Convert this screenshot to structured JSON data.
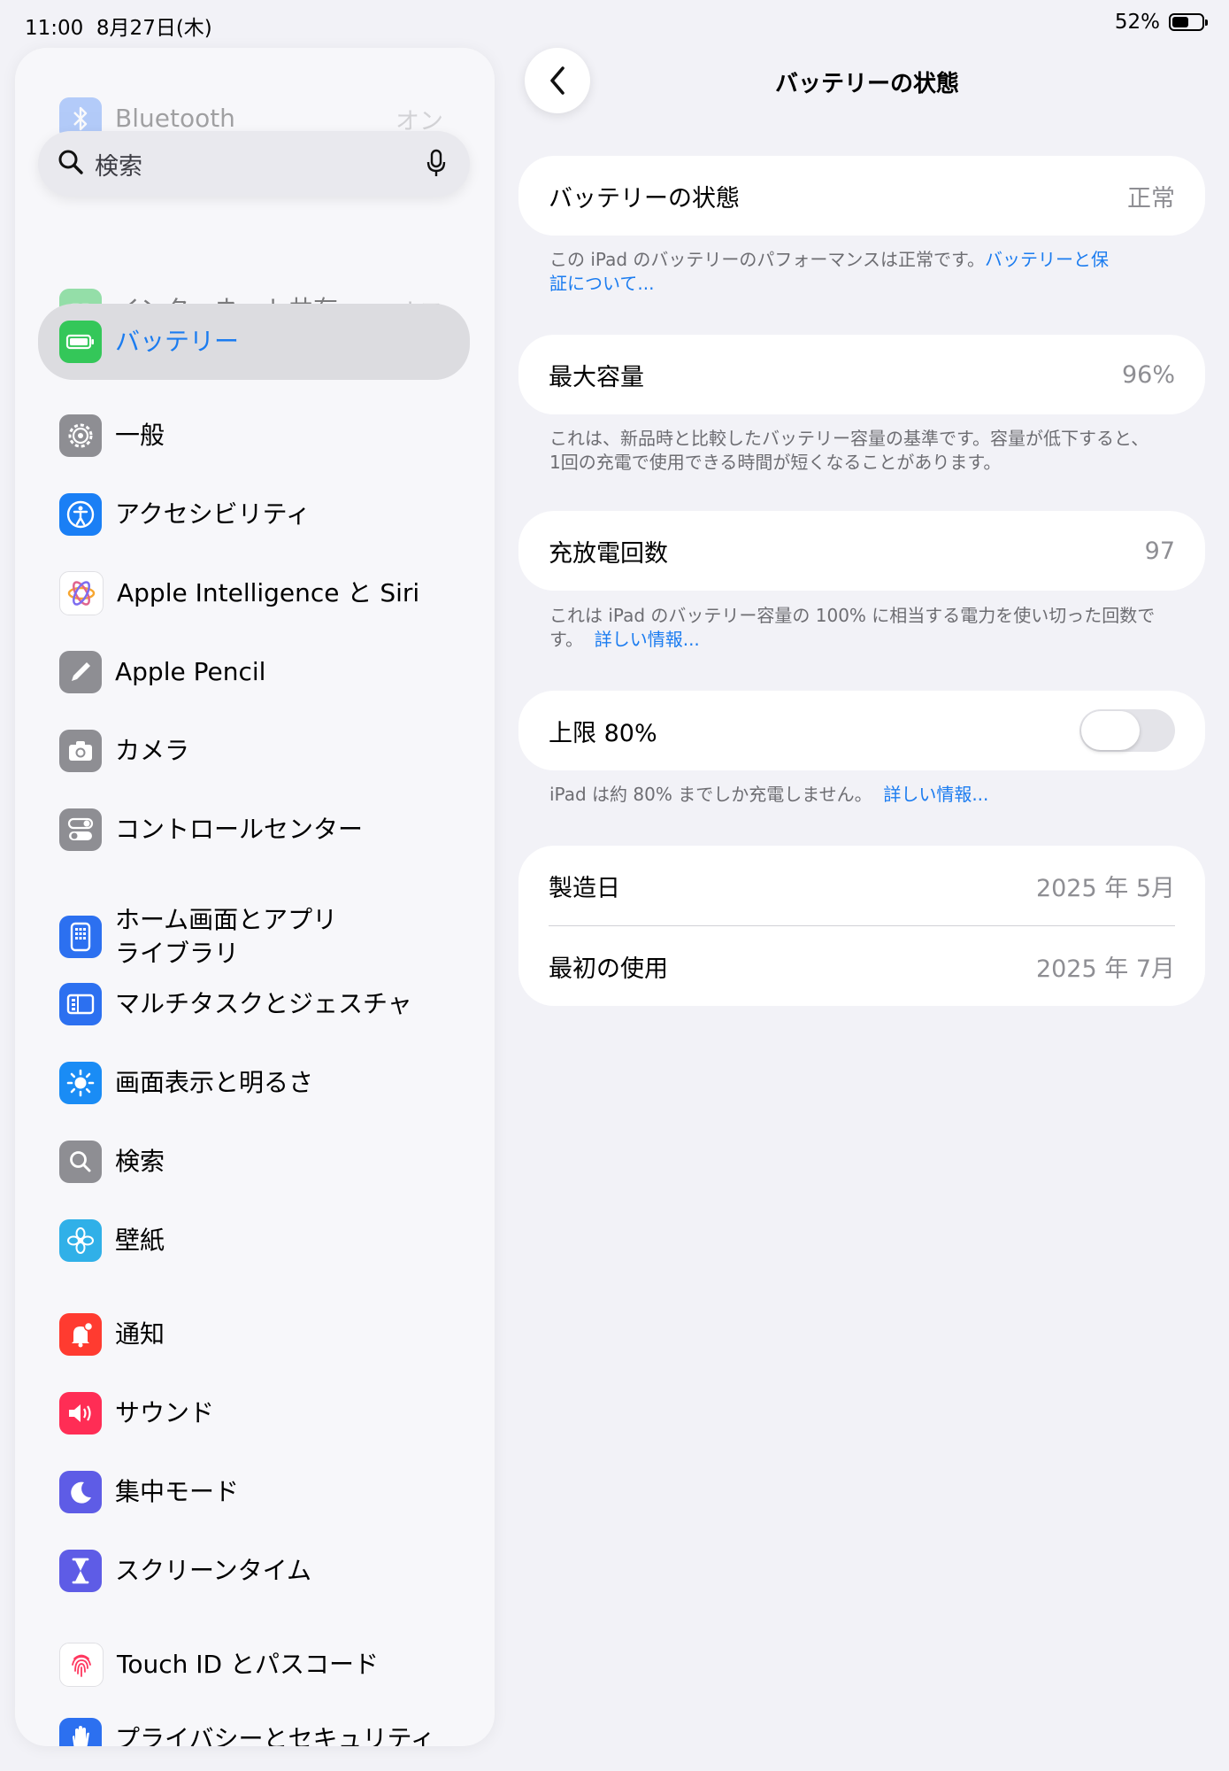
{
  "status_bar": {
    "time": "11:00",
    "date": "8月27日(木)",
    "battery_percent": "52%",
    "battery_level": 0.52
  },
  "sidebar": {
    "search_placeholder": "検索",
    "top_items": [
      {
        "label": "Bluetooth",
        "value": "オン",
        "icon": "bluetooth-icon",
        "color": "#3478f6"
      },
      {
        "label": "インターネット共有",
        "value": "オフ",
        "icon": "link-icon",
        "color": "#34c759"
      }
    ],
    "selected_item": {
      "label": "バッテリー",
      "icon": "battery-icon",
      "color": "#34c759"
    },
    "items": [
      {
        "label": "一般",
        "icon": "gear-icon",
        "color": "#8e8e93"
      },
      {
        "label": "アクセシビリティ",
        "icon": "accessibility-icon",
        "color": "#1a7ff5"
      },
      {
        "label": "Apple Intelligence と Siri",
        "icon": "siri-icon",
        "color": "#e0648f"
      },
      {
        "label": "Apple Pencil",
        "icon": "pencil-icon",
        "color": "#8e8e93"
      },
      {
        "label": "カメラ",
        "icon": "camera-icon",
        "color": "#8e8e93"
      },
      {
        "label": "コントロールセンター",
        "icon": "toggles-icon",
        "color": "#8e8e93"
      },
      {
        "label": "ホーム画面とアプリ",
        "label2": "ライブラリ",
        "icon": "home-screen-icon",
        "color": "#2c70f0"
      },
      {
        "label": "マルチタスクとジェスチャ",
        "icon": "multitask-icon",
        "color": "#2c70f0"
      },
      {
        "label": "画面表示と明るさ",
        "icon": "sun-icon",
        "color": "#1a8cf5"
      },
      {
        "label": "検索",
        "icon": "search-icon",
        "color": "#8e8e93"
      },
      {
        "label": "壁紙",
        "icon": "flower-icon",
        "color": "#30b0e8"
      },
      {
        "label": "通知",
        "icon": "bell-icon",
        "color": "#ff3b30"
      },
      {
        "label": "サウンド",
        "icon": "speaker-icon",
        "color": "#ff2d55"
      },
      {
        "label": "集中モード",
        "icon": "moon-icon",
        "color": "#5e5ce6"
      },
      {
        "label": "スクリーンタイム",
        "icon": "hourglass-icon",
        "color": "#5e5ce6"
      },
      {
        "label": "Touch ID とパスコード",
        "icon": "fingerprint-icon",
        "color": "#ffffff"
      },
      {
        "label": "プライバシーとセキュリティ",
        "icon": "hand-icon",
        "color": "#2c70f0"
      }
    ]
  },
  "detail": {
    "title": "バッテリーの状態",
    "health": {
      "label": "バッテリーの状態",
      "value": "正常"
    },
    "health_note": {
      "text": "この iPad のバッテリーのパフォーマンスは正常です。",
      "link1": "バッテリーと保",
      "link2": "証について..."
    },
    "max_capacity": {
      "label": "最大容量",
      "value": "96%"
    },
    "capacity_note": {
      "line1": "これは、新品時と比較したバッテリー容量の基準です。容量が低下すると、",
      "line2": "1回の充電で使用できる時間が短くなることがあります。"
    },
    "cycle_count": {
      "label": "充放電回数",
      "value": "97"
    },
    "cycle_note": {
      "line1": "これは iPad のバッテリー容量の 100% に相当する電力を使い切った回数で",
      "line2": "す。",
      "link": "詳しい情報..."
    },
    "limit": {
      "label": "上限 80%",
      "enabled": false
    },
    "limit_note": {
      "text": "iPad は約 80% までしか充電しません。",
      "link": "詳しい情報..."
    },
    "manufacture_date": {
      "label": "製造日",
      "value": "2025 年 5月"
    },
    "first_use": {
      "label": "最初の使用",
      "value": "2025 年 7月"
    }
  }
}
